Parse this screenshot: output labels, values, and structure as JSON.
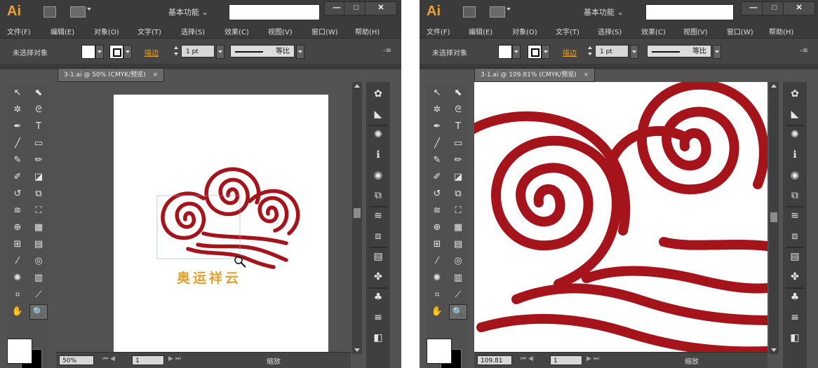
{
  "app": {
    "logo": "Ai",
    "workspace": "基本功能 ⌄"
  },
  "window_buttons": {
    "minimize": "—",
    "maximize": "□",
    "close": "✕"
  },
  "menu": [
    "文件(F)",
    "编辑(E)",
    "对象(O)",
    "文字(T)",
    "选择(S)",
    "效果(C)",
    "视图(V)",
    "窗口(W)",
    "帮助(H)"
  ],
  "control": {
    "no_selection": "未选择对象",
    "stroke_label": "描边",
    "stroke_weight": "1 pt",
    "profile": "等比",
    "panel_menu": "-≡"
  },
  "left": {
    "tab": "3-1.ai @ 50% (CMYK/预览)",
    "tab_close": "×",
    "zoom": "50%",
    "page": "1",
    "zoom_label": "缩放",
    "logo_text": "奥运祥云",
    "colors": {
      "cloud": "#a5141b",
      "text": "#e0a22a"
    }
  },
  "right": {
    "tab": "3-1.ai @ 109.81% (CMYK/预览)",
    "tab_close": "×",
    "zoom": "109.81",
    "page": "1",
    "zoom_label": "缩放"
  },
  "tools": [
    {
      "name": "selection-tool-icon",
      "glyph": "↖"
    },
    {
      "name": "direct-selection-tool-icon",
      "glyph": "⬉"
    },
    {
      "name": "magic-wand-icon",
      "glyph": "✲"
    },
    {
      "name": "lasso-icon",
      "glyph": "ᘓ"
    },
    {
      "name": "pen-tool-icon",
      "glyph": "✒"
    },
    {
      "name": "type-tool-icon",
      "glyph": "T"
    },
    {
      "name": "line-tool-icon",
      "glyph": "╱"
    },
    {
      "name": "rectangle-tool-icon",
      "glyph": "▭"
    },
    {
      "name": "paintbrush-icon",
      "glyph": "✎"
    },
    {
      "name": "pencil-icon",
      "glyph": "✏"
    },
    {
      "name": "blob-brush-icon",
      "glyph": "✐"
    },
    {
      "name": "eraser-icon",
      "glyph": "◪"
    },
    {
      "name": "rotate-tool-icon",
      "glyph": "↺"
    },
    {
      "name": "scale-tool-icon",
      "glyph": "⧉"
    },
    {
      "name": "warp-tool-icon",
      "glyph": "≋"
    },
    {
      "name": "free-transform-icon",
      "glyph": "⛶"
    },
    {
      "name": "shape-builder-icon",
      "glyph": "⊕"
    },
    {
      "name": "perspective-grid-icon",
      "glyph": "▦"
    },
    {
      "name": "mesh-tool-icon",
      "glyph": "⊞"
    },
    {
      "name": "gradient-tool-icon",
      "glyph": "▤"
    },
    {
      "name": "eyedropper-icon",
      "glyph": "⁄"
    },
    {
      "name": "blend-tool-icon",
      "glyph": "◎"
    },
    {
      "name": "symbol-sprayer-icon",
      "glyph": "✺"
    },
    {
      "name": "column-graph-icon",
      "glyph": "▥"
    },
    {
      "name": "artboard-tool-icon",
      "glyph": "⌗"
    },
    {
      "name": "slice-tool-icon",
      "glyph": "⟋"
    },
    {
      "name": "hand-tool-icon",
      "glyph": "✋"
    },
    {
      "name": "zoom-tool-icon",
      "glyph": "🔍"
    }
  ],
  "dock": [
    "color-guide-icon",
    "swatches-icon",
    "symbols-icon",
    "info-icon",
    "appearance-icon",
    "graphic-styles-icon",
    "layers-icon",
    "artboards-icon",
    "align-icon",
    "transform-icon",
    "pathfinder-icon",
    "stroke-icon",
    "transparency-icon"
  ]
}
